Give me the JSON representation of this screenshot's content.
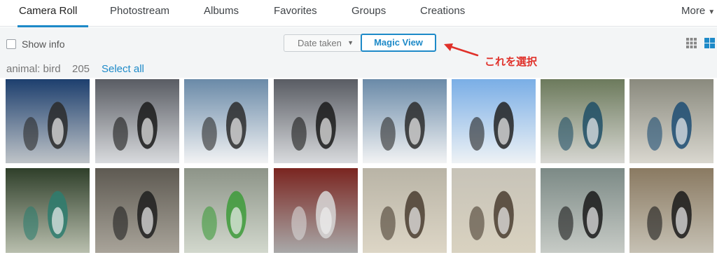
{
  "nav": {
    "tabs": [
      "Camera Roll",
      "Photostream",
      "Albums",
      "Favorites",
      "Groups",
      "Creations"
    ],
    "more_label": "More"
  },
  "toolbar": {
    "show_info_label": "Show info",
    "show_info_checked": false,
    "date_taken_label": "Date taken",
    "magic_view_label": "Magic View",
    "annotation": "これを選択"
  },
  "results": {
    "label": "animal: bird",
    "count": "205",
    "select_all": "Select all"
  },
  "icons": {
    "grid_view": "grid-small-icon",
    "tile_view": "grid-large-icon",
    "annotation_arrow": "arrow-icon"
  },
  "colors": {
    "accent": "#1e8ac8",
    "annotation": "#e0312a"
  },
  "photos": [
    {
      "subject": "penguins in aquarium",
      "palette": [
        "#1d3f6e",
        "#bfc4c8",
        "#2a2a2a"
      ]
    },
    {
      "subject": "penguins with visitors",
      "palette": [
        "#595c63",
        "#d9dbde",
        "#1a1a1a"
      ]
    },
    {
      "subject": "penguins on snow",
      "palette": [
        "#6a8aa8",
        "#f2f3f4",
        "#2b2b2b"
      ]
    },
    {
      "subject": "penguins with visitors",
      "palette": [
        "#595c63",
        "#d9dbde",
        "#1a1a1a"
      ]
    },
    {
      "subject": "penguins on snow",
      "palette": [
        "#6a8aa8",
        "#f2f3f4",
        "#2b2b2b"
      ]
    },
    {
      "subject": "penguin under blue sky",
      "palette": [
        "#7aaee6",
        "#eef2f5",
        "#222"
      ]
    },
    {
      "subject": "peacock in park",
      "palette": [
        "#6c7a5c",
        "#d7d7d2",
        "#1f4f66"
      ]
    },
    {
      "subject": "peacock on ground",
      "palette": [
        "#8a8a7e",
        "#d9d7cf",
        "#1c4c73"
      ]
    },
    {
      "subject": "peacock with tail",
      "palette": [
        "#2f3f2a",
        "#b9bfae",
        "#2d7d6e"
      ]
    },
    {
      "subject": "penguins on rocks",
      "palette": [
        "#5e5a52",
        "#a9a49a",
        "#1f1f1f"
      ]
    },
    {
      "subject": "parrot on hand",
      "palette": [
        "#8d9488",
        "#d2d8cd",
        "#3d9b3a"
      ]
    },
    {
      "subject": "grey parrot",
      "palette": [
        "#7a2520",
        "#a9a9a9",
        "#d8d8d8"
      ]
    },
    {
      "subject": "ostriches in field",
      "palette": [
        "#b9b4a6",
        "#ddd6c6",
        "#4a3d30"
      ]
    },
    {
      "subject": "ostriches with fence",
      "palette": [
        "#c7c3b8",
        "#d9d2c0",
        "#4a3d30"
      ]
    },
    {
      "subject": "toucan",
      "palette": [
        "#7c8a86",
        "#c7cbc6",
        "#1a1a1a"
      ]
    },
    {
      "subject": "toucan on branch",
      "palette": [
        "#8a7a62",
        "#c6c1b4",
        "#1a1a1a"
      ]
    }
  ]
}
